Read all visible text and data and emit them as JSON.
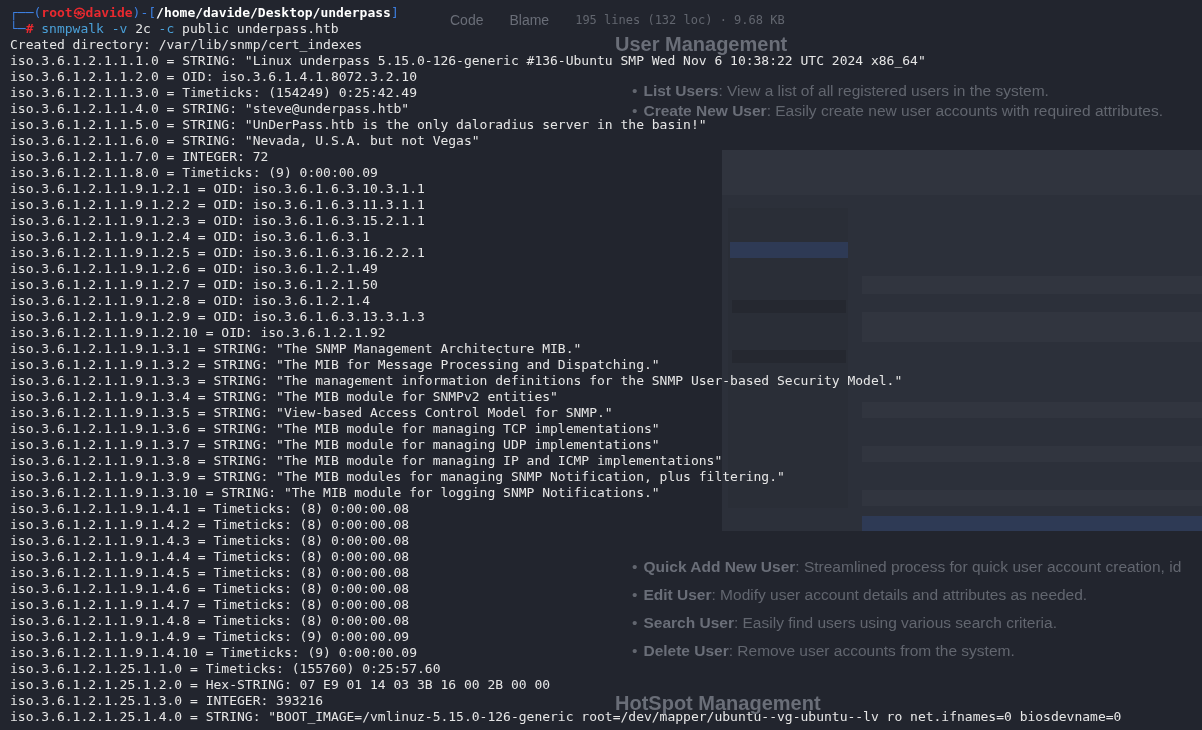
{
  "background_page": {
    "tabs": [
      {
        "label": "Code",
        "selected": false
      },
      {
        "label": "Blame",
        "selected": false
      }
    ],
    "file_info": "195 lines (132 loc) · 9.68 KB",
    "sections": [
      {
        "heading": "User Management",
        "items_before": [
          {
            "marker": "•",
            "term": "List Users",
            "text": ": View a list of all registered users in the system."
          },
          {
            "marker": "•",
            "term": "Create New User",
            "text": ": Easily create new user accounts with required attributes."
          }
        ],
        "items_after": [
          {
            "marker": "•",
            "term": "Quick Add New User",
            "text": ": Streamlined process for quick user account creation, id"
          },
          {
            "marker": "•",
            "term": "Edit User",
            "text": ": Modify user account details and attributes as needed."
          },
          {
            "marker": "•",
            "term": "Search User",
            "text": ": Easily find users using various search criteria."
          },
          {
            "marker": "•",
            "term": "Delete User",
            "text": ": Remove user accounts from the system."
          }
        ]
      },
      {
        "heading": "HotSpot Management"
      }
    ]
  },
  "terminal": {
    "prompt": {
      "open": "┌──(",
      "user": "root㉿davide",
      "mid": ")-[",
      "path": "/home/davide/Desktop/underpass",
      "close": "]",
      "corner": "└─",
      "sign": "#"
    },
    "command": [
      {
        "text": "snmpwalk",
        "kind": "program"
      },
      {
        "text": "-v",
        "kind": "flag"
      },
      {
        "text": "2c",
        "kind": "arg"
      },
      {
        "text": "-c",
        "kind": "flag"
      },
      {
        "text": "public",
        "kind": "arg"
      },
      {
        "text": "underpass.htb",
        "kind": "arg"
      }
    ],
    "output": [
      "Created directory: /var/lib/snmp/cert_indexes",
      "iso.3.6.1.2.1.1.1.0 = STRING: \"Linux underpass 5.15.0-126-generic #136-Ubuntu SMP Wed Nov 6 10:38:22 UTC 2024 x86_64\"",
      "iso.3.6.1.2.1.1.2.0 = OID: iso.3.6.1.4.1.8072.3.2.10",
      "iso.3.6.1.2.1.1.3.0 = Timeticks: (154249) 0:25:42.49",
      "iso.3.6.1.2.1.1.4.0 = STRING: \"steve@underpass.htb\"",
      "iso.3.6.1.2.1.1.5.0 = STRING: \"UnDerPass.htb is the only daloradius server in the basin!\"",
      "iso.3.6.1.2.1.1.6.0 = STRING: \"Nevada, U.S.A. but not Vegas\"",
      "iso.3.6.1.2.1.1.7.0 = INTEGER: 72",
      "iso.3.6.1.2.1.1.8.0 = Timeticks: (9) 0:00:00.09",
      "iso.3.6.1.2.1.1.9.1.2.1 = OID: iso.3.6.1.6.3.10.3.1.1",
      "iso.3.6.1.2.1.1.9.1.2.2 = OID: iso.3.6.1.6.3.11.3.1.1",
      "iso.3.6.1.2.1.1.9.1.2.3 = OID: iso.3.6.1.6.3.15.2.1.1",
      "iso.3.6.1.2.1.1.9.1.2.4 = OID: iso.3.6.1.6.3.1",
      "iso.3.6.1.2.1.1.9.1.2.5 = OID: iso.3.6.1.6.3.16.2.2.1",
      "iso.3.6.1.2.1.1.9.1.2.6 = OID: iso.3.6.1.2.1.49",
      "iso.3.6.1.2.1.1.9.1.2.7 = OID: iso.3.6.1.2.1.50",
      "iso.3.6.1.2.1.1.9.1.2.8 = OID: iso.3.6.1.2.1.4",
      "iso.3.6.1.2.1.1.9.1.2.9 = OID: iso.3.6.1.6.3.13.3.1.3",
      "iso.3.6.1.2.1.1.9.1.2.10 = OID: iso.3.6.1.2.1.92",
      "iso.3.6.1.2.1.1.9.1.3.1 = STRING: \"The SNMP Management Architecture MIB.\"",
      "iso.3.6.1.2.1.1.9.1.3.2 = STRING: \"The MIB for Message Processing and Dispatching.\"",
      "iso.3.6.1.2.1.1.9.1.3.3 = STRING: \"The management information definitions for the SNMP User-based Security Model.\"",
      "iso.3.6.1.2.1.1.9.1.3.4 = STRING: \"The MIB module for SNMPv2 entities\"",
      "iso.3.6.1.2.1.1.9.1.3.5 = STRING: \"View-based Access Control Model for SNMP.\"",
      "iso.3.6.1.2.1.1.9.1.3.6 = STRING: \"The MIB module for managing TCP implementations\"",
      "iso.3.6.1.2.1.1.9.1.3.7 = STRING: \"The MIB module for managing UDP implementations\"",
      "iso.3.6.1.2.1.1.9.1.3.8 = STRING: \"The MIB module for managing IP and ICMP implementations\"",
      "iso.3.6.1.2.1.1.9.1.3.9 = STRING: \"The MIB modules for managing SNMP Notification, plus filtering.\"",
      "iso.3.6.1.2.1.1.9.1.3.10 = STRING: \"The MIB module for logging SNMP Notifications.\"",
      "iso.3.6.1.2.1.1.9.1.4.1 = Timeticks: (8) 0:00:00.08",
      "iso.3.6.1.2.1.1.9.1.4.2 = Timeticks: (8) 0:00:00.08",
      "iso.3.6.1.2.1.1.9.1.4.3 = Timeticks: (8) 0:00:00.08",
      "iso.3.6.1.2.1.1.9.1.4.4 = Timeticks: (8) 0:00:00.08",
      "iso.3.6.1.2.1.1.9.1.4.5 = Timeticks: (8) 0:00:00.08",
      "iso.3.6.1.2.1.1.9.1.4.6 = Timeticks: (8) 0:00:00.08",
      "iso.3.6.1.2.1.1.9.1.4.7 = Timeticks: (8) 0:00:00.08",
      "iso.3.6.1.2.1.1.9.1.4.8 = Timeticks: (8) 0:00:00.08",
      "iso.3.6.1.2.1.1.9.1.4.9 = Timeticks: (9) 0:00:00.09",
      "iso.3.6.1.2.1.1.9.1.4.10 = Timeticks: (9) 0:00:00.09",
      "iso.3.6.1.2.1.25.1.1.0 = Timeticks: (155760) 0:25:57.60",
      "iso.3.6.1.2.1.25.1.2.0 = Hex-STRING: 07 E9 01 14 03 3B 16 00 2B 00 00",
      "iso.3.6.1.2.1.25.1.3.0 = INTEGER: 393216",
      "iso.3.6.1.2.1.25.1.4.0 = STRING: \"BOOT_IMAGE=/vmlinuz-5.15.0-126-generic root=/dev/mapper/ubuntu--vg-ubuntu--lv ro net.ifnames=0 biosdevname=0"
    ]
  }
}
